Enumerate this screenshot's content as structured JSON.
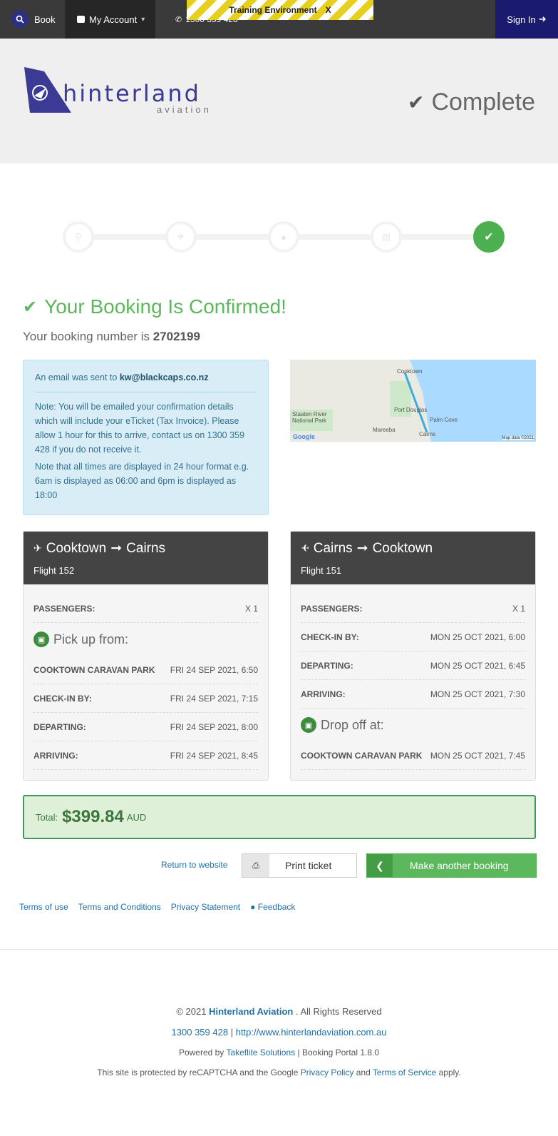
{
  "topbar": {
    "book_label": "Book",
    "account_label": "My Account",
    "phone": "1300 359 428",
    "training_label": "Training Environment",
    "training_close": "X",
    "sign_in_label": "Sign In"
  },
  "header": {
    "logo_word": "hinterland",
    "logo_sub": "aviation",
    "status": "Complete"
  },
  "steps": [
    "search-icon",
    "plane-icon",
    "user-icon",
    "card-icon",
    "check-icon"
  ],
  "confirmation": {
    "title": "Your Booking Is Confirmed!",
    "number_prefix": "Your booking number is",
    "number": "2702199"
  },
  "info": {
    "email_prefix": "An email was sent to",
    "email": "kw@blackcaps.co.nz",
    "note1": "Note: You will be emailed your confirmation details which will include your eTicket (Tax Invoice). Please allow 1 hour for this to arrive, contact us on 1300 359 428 if you do not receive it.",
    "note2": "Note that all times are displayed in 24 hour format e.g. 6am is displayed as 06:00 and 6pm is displayed as 18:00"
  },
  "map": {
    "label_cooktown": "Cooktown",
    "label_park": "Staaten River National Park",
    "label_portdouglas": "Port Douglas",
    "label_cairns": "Cairns",
    "label_mareeba": "Mareeba",
    "label_palmcove": "Palm Cove",
    "google": "Google",
    "map_data": "Map data ©2021"
  },
  "outbound": {
    "from": "Cooktown",
    "to": "Cairns",
    "flight": "Flight 152",
    "passengers_label": "PASSENGERS:",
    "passengers": "X 1",
    "pickup_title": "Pick up from:",
    "pickup_place": "COOKTOWN CARAVAN PARK",
    "pickup_time": "FRI 24 SEP 2021, 6:50",
    "checkin_label": "CHECK-IN BY:",
    "checkin": "FRI 24 SEP 2021, 7:15",
    "departing_label": "DEPARTING:",
    "departing": "FRI 24 SEP 2021, 8:00",
    "arriving_label": "ARRIVING:",
    "arriving": "FRI 24 SEP 2021, 8:45"
  },
  "return": {
    "from": "Cairns",
    "to": "Cooktown",
    "flight": "Flight 151",
    "passengers_label": "PASSENGERS:",
    "passengers": "X 1",
    "checkin_label": "CHECK-IN BY:",
    "checkin": "MON 25 OCT 2021, 6:00",
    "departing_label": "DEPARTING:",
    "departing": "MON 25 OCT 2021, 6:45",
    "arriving_label": "ARRIVING:",
    "arriving": "MON 25 OCT 2021, 7:30",
    "dropoff_title": "Drop off at:",
    "dropoff_place": "COOKTOWN CARAVAN PARK",
    "dropoff_time": "MON 25 OCT 2021, 7:45"
  },
  "total": {
    "label": "Total:",
    "amount": "$399.84",
    "currency": "AUD"
  },
  "actions": {
    "return_label": "Return to website",
    "print_label": "Print ticket",
    "another_label": "Make another booking"
  },
  "links": {
    "terms_of_use": "Terms of use",
    "terms_conditions": "Terms and Conditions",
    "privacy": "Privacy Statement",
    "feedback": "Feedback"
  },
  "footer": {
    "copyright_prefix": "© 2021",
    "company": "Hinterland Aviation",
    "copyright_suffix": ". All Rights Reserved",
    "phone": "1300 359 428",
    "sep": "|",
    "website": "http://www.hinterlandaviation.com.au",
    "powered_prefix": "Powered by",
    "powered_by": "Takeflite Solutions",
    "portal": "| Booking Portal 1.8.0",
    "recaptcha_prefix": "This site is protected by reCAPTCHA and the Google",
    "privacy_policy": "Privacy Policy",
    "and": "and",
    "terms_of_service": "Terms of Service",
    "apply": "apply."
  },
  "colors": {
    "brand": "#3b3a94",
    "success": "#5cb85c",
    "topbar": "#3a3a3a",
    "info_bg": "#d9edf7"
  }
}
